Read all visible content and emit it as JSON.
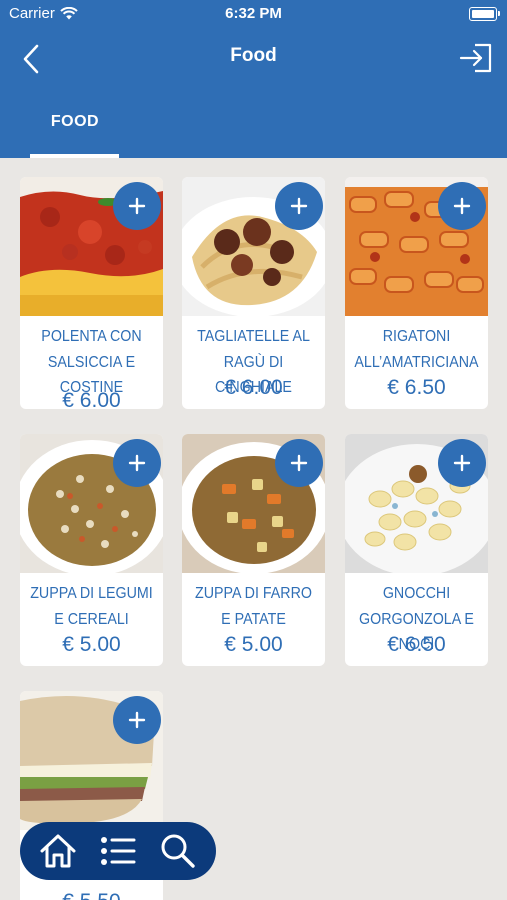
{
  "status_bar": {
    "carrier": "Carrier",
    "time": "6:32 PM"
  },
  "navbar": {
    "title": "Food"
  },
  "tabs": [
    {
      "label": "FOOD",
      "active": true
    }
  ],
  "colors": {
    "primary": "#2f6eb5",
    "bottom_nav": "#0c3a7b",
    "background": "#e9e7e4"
  },
  "icons": [
    "wifi-icon",
    "battery-icon",
    "back-arrow-icon",
    "logout-icon",
    "plus-icon",
    "home-icon",
    "list-icon",
    "search-icon"
  ],
  "products": [
    {
      "name": "POLENTA CON SALSICCIA E COSTINE",
      "price": "€ 6.00"
    },
    {
      "name": "TAGLIATELLE AL RAGÙ DI CINGHIALE",
      "price": "€ 6.00"
    },
    {
      "name": "RIGATONI ALL’AMATRICIANA",
      "price": "€ 6.50"
    },
    {
      "name": "ZUPPA DI  LEGUMI E CEREALI",
      "price": "€ 5.00"
    },
    {
      "name": "ZUPPA DI FARRO E PATATE",
      "price": "€ 5.00"
    },
    {
      "name": "GNOCCHI GORGONZOLA E NOCI",
      "price": "€ 6.50"
    },
    {
      "name": "",
      "price": "€ 5.50"
    }
  ]
}
